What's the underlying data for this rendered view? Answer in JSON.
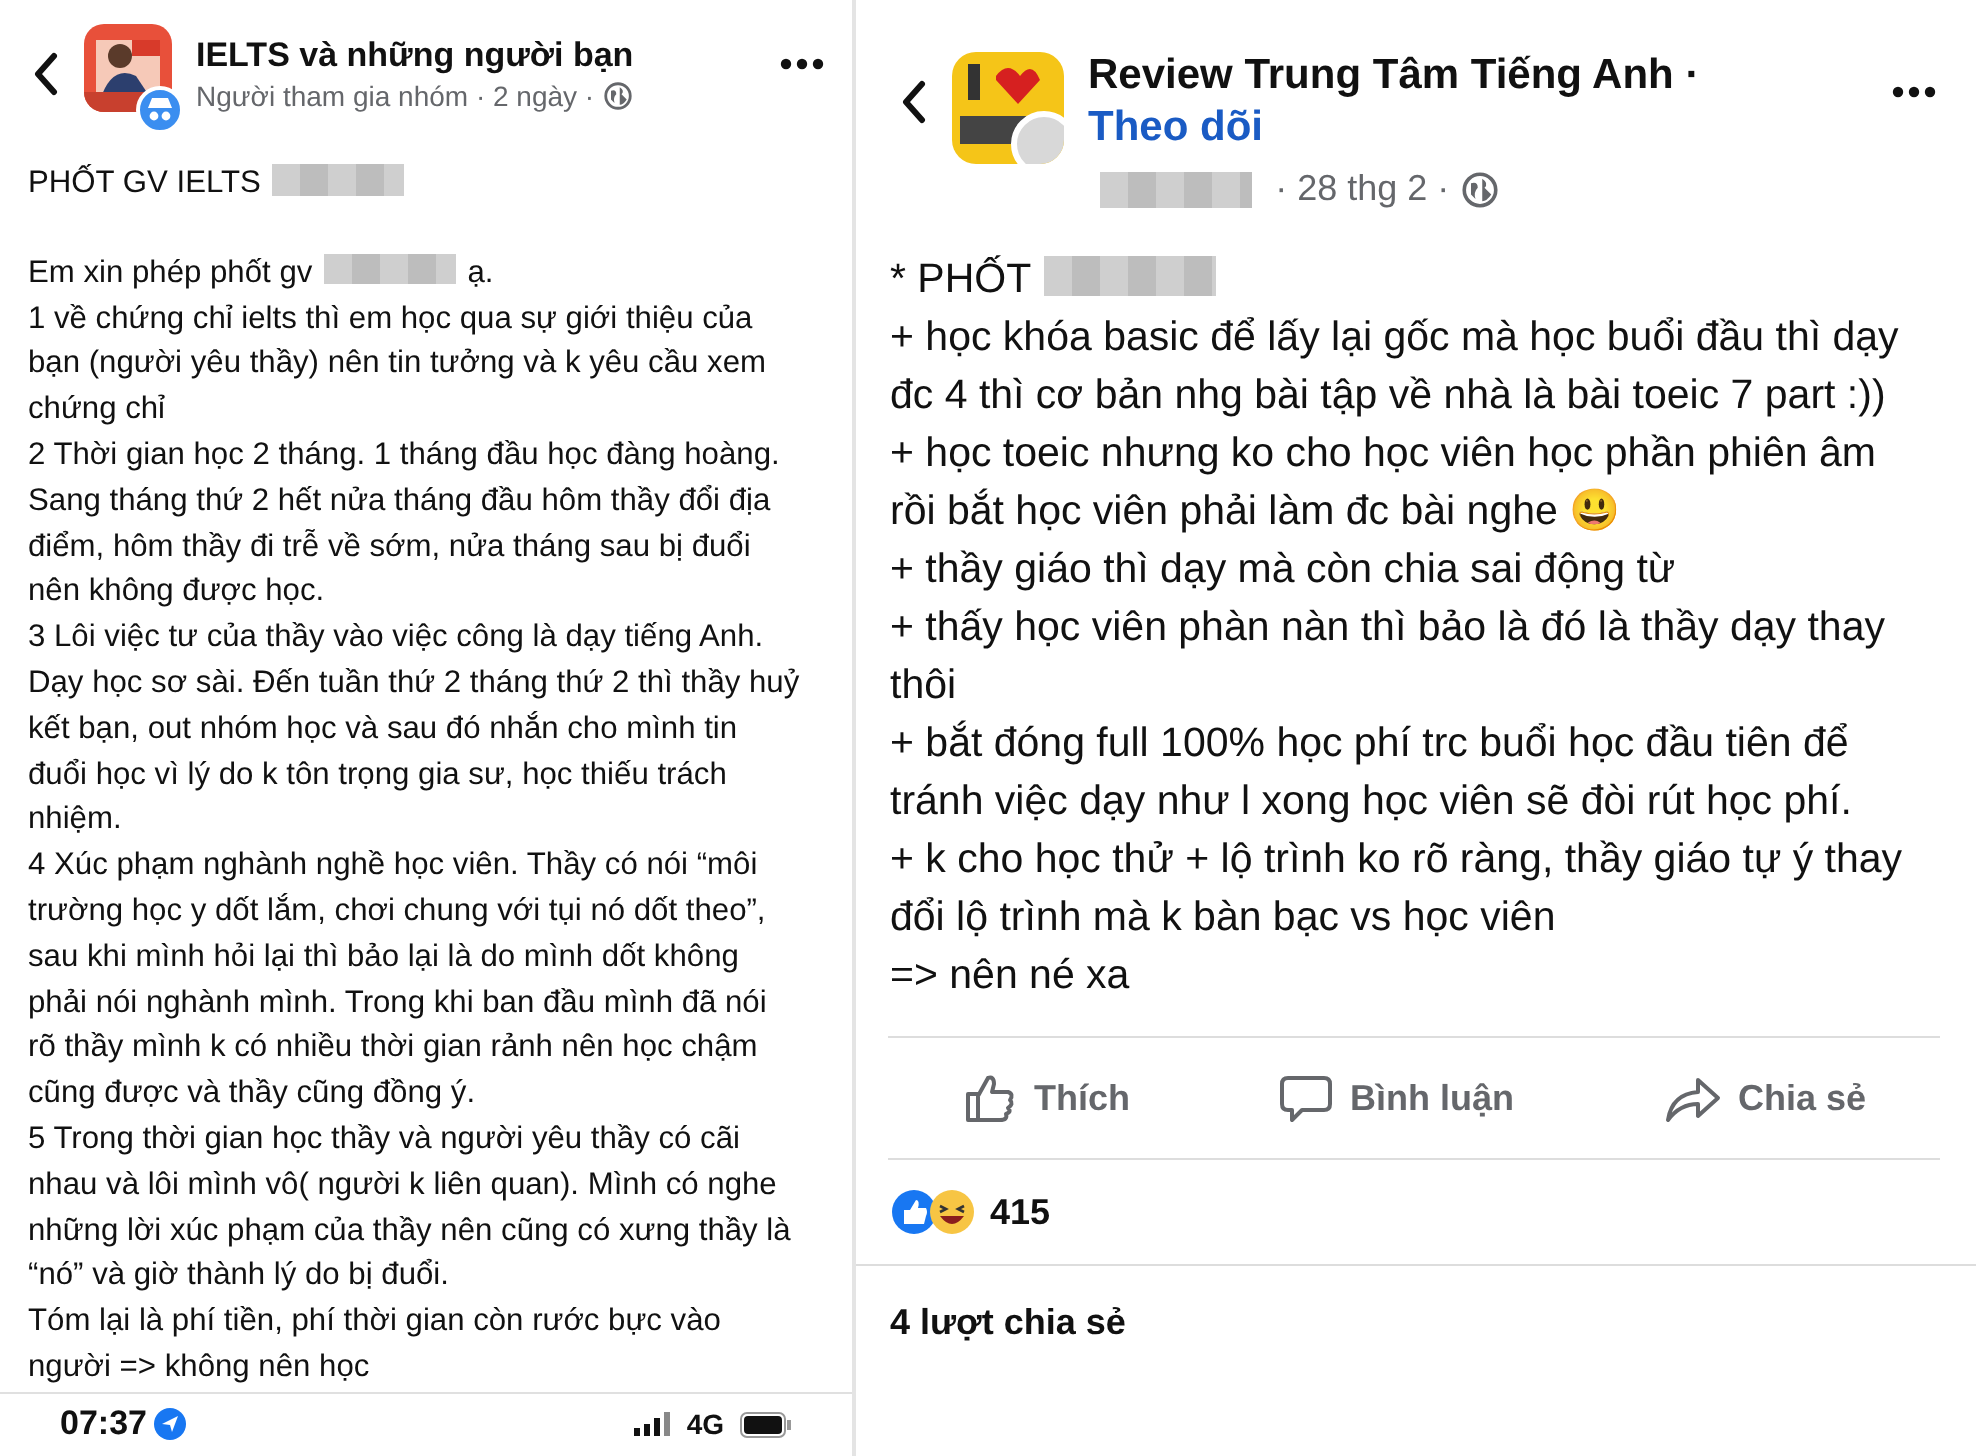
{
  "left_post": {
    "group_name": "IELTS và những người bạn",
    "meta": "Người tham gia nhóm · 2 ngày ·",
    "paragraphs": [
      {
        "kind": "heading",
        "segments": [
          {
            "kind": "text",
            "text": "PHỐT GV IELTS"
          },
          {
            "kind": "redaction"
          }
        ]
      },
      {
        "kind": "line",
        "segments": [
          {
            "kind": "text",
            "text": "Em xin phép phốt gv"
          },
          {
            "kind": "redaction"
          },
          {
            "kind": "text",
            "text": "ạ."
          }
        ]
      },
      {
        "kind": "line",
        "segments": [
          {
            "kind": "text",
            "text": "1 về chứng chỉ ielts thì em học qua sự giới thiệu của bạn (người yêu thầy) nên tin tưởng và k yêu cầu xem chứng chỉ"
          }
        ]
      },
      {
        "kind": "line",
        "segments": [
          {
            "kind": "text",
            "text": "2 Thời gian học 2 tháng. 1 tháng đầu học đàng hoàng. Sang tháng thứ 2 hết nửa tháng đầu hôm thầy đổi địa điểm, hôm thầy đi trễ về sớm, nửa tháng sau bị đuổi nên không được học."
          }
        ]
      },
      {
        "kind": "line",
        "segments": [
          {
            "kind": "text",
            "text": "3 Lôi việc tư của thầy vào việc công là dạy tiếng Anh. Dạy học sơ sài. Đến tuần thứ 2 tháng thứ 2 thì thầy huỷ kết bạn, out nhóm học và sau đó nhắn cho mình tin đuổi học vì lý do k tôn trọng gia sư, học thiếu trách nhiệm."
          }
        ]
      },
      {
        "kind": "line",
        "segments": [
          {
            "kind": "text",
            "text": "4 Xúc phạm nghành nghề học viên. Thầy có nói “môi trường học y dốt lắm, chơi chung với tụi nó dốt theo”, sau khi mình hỏi lại thì bảo lại là do mình dốt không phải nói nghành mình. Trong khi ban đầu mình đã nói rõ thầy mình k có nhiều thời gian rảnh nên học chậm cũng được và thầy cũng đồng ý."
          }
        ]
      },
      {
        "kind": "line",
        "segments": [
          {
            "kind": "text",
            "text": "5 Trong thời gian học thầy và người yêu thầy có cãi nhau và lôi mình vô( người k liên quan). Mình có nghe những lời xúc phạm của thầy nên cũng có xưng thầy là “nó” và giờ thành lý do bị đuổi."
          }
        ]
      },
      {
        "kind": "line",
        "segments": [
          {
            "kind": "text",
            "text": "Tóm lại là phí tiền, phí thời gian còn rước bực vào người => không nên học"
          }
        ]
      }
    ]
  },
  "status_bar": {
    "time": "07:37",
    "network": "4G"
  },
  "right_post": {
    "page_name": "Review Trung Tâm Tiếng Anh ·",
    "follow": "Theo dõi",
    "meta": "· 28 thg 2 ·",
    "paragraphs": [
      {
        "kind": "line",
        "segments": [
          {
            "kind": "text",
            "text": "* PHỐT"
          },
          {
            "kind": "redaction"
          }
        ]
      },
      {
        "kind": "line",
        "segments": [
          {
            "kind": "text",
            "text": "+ học khóa basic để lấy lại gốc mà học buổi đầu thì dạy đc 4 thì cơ bản nhg bài tập về nhà là bài toeic 7 part :))"
          }
        ]
      },
      {
        "kind": "line",
        "segments": [
          {
            "kind": "text",
            "text": "+ học toeic nhưng ko cho học viên học phần phiên âm rồi bắt học viên phải làm đc bài nghe 😃"
          }
        ]
      },
      {
        "kind": "line",
        "segments": [
          {
            "kind": "text",
            "text": "+ thầy giáo thì dạy mà còn chia sai động từ"
          }
        ]
      },
      {
        "kind": "line",
        "segments": [
          {
            "kind": "text",
            "text": "+ thấy học viên phàn nàn thì bảo là đó là thầy dạy thay thôi"
          }
        ]
      },
      {
        "kind": "line",
        "segments": [
          {
            "kind": "text",
            "text": "+ bắt đóng full 100% học phí trc buổi học đầu tiên để tránh việc dạy như l xong học viên sẽ đòi rút học phí."
          }
        ]
      },
      {
        "kind": "line",
        "segments": [
          {
            "kind": "text",
            "text": "+ k cho học thử + lộ trình ko rõ ràng, thầy giáo tự ý thay đổi lộ trình mà k bàn bạc vs học viên"
          }
        ]
      },
      {
        "kind": "line",
        "segments": [
          {
            "kind": "text",
            "text": "=> nên né xa"
          }
        ]
      }
    ],
    "actions": [
      {
        "kind": "like",
        "label": "Thích"
      },
      {
        "kind": "comment",
        "label": "Bình luận"
      },
      {
        "kind": "share",
        "label": "Chia sẻ"
      }
    ],
    "reaction_count": "415",
    "shares": "4 lượt chia sẻ"
  }
}
